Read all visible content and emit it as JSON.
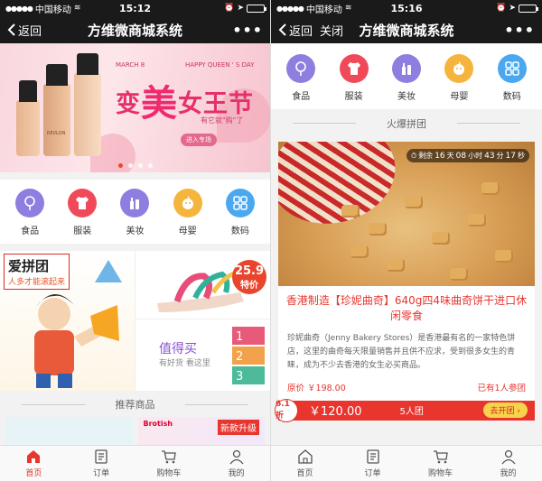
{
  "left": {
    "status": {
      "carrier": "中国移动",
      "time": "15:12"
    },
    "nav": {
      "back_label": "返回",
      "title": "方维微商城系统",
      "more": "•••"
    },
    "banner": {
      "march": "MARCH 8",
      "happy": "HAPPY QUEEN ' S DAY",
      "headline_pre": "变",
      "headline_mei": "美",
      "headline_post": "女王节",
      "sub": "有它就\"购\"了",
      "button": "进入专场",
      "brand": "REVLON"
    },
    "categories": [
      {
        "label": "食品",
        "icon": "lollipop-icon",
        "color": "#8e7ee0"
      },
      {
        "label": "服装",
        "icon": "shirt-icon",
        "color": "#f04a5a"
      },
      {
        "label": "美妆",
        "icon": "cosmetics-icon",
        "color": "#8e7ee0"
      },
      {
        "label": "母婴",
        "icon": "baby-icon",
        "color": "#f5b43c"
      },
      {
        "label": "数码",
        "icon": "grid-icon",
        "color": "#4aa8f0"
      }
    ],
    "promo": {
      "group_title": "爱拼团",
      "group_sub": "人多才能滚起来",
      "price_num": "25.9",
      "price_tag": "特价",
      "worth_title": "值得买",
      "worth_sub": "有好货 看这里"
    },
    "section_title": "推荐商品",
    "rec": {
      "tag": "新款升级",
      "brand": "Brotish"
    },
    "tabs": [
      "首页",
      "订单",
      "购物车",
      "我的"
    ]
  },
  "right": {
    "status": {
      "carrier": "中国移动",
      "time": "15:16"
    },
    "nav": {
      "back_label": "返回",
      "close_label": "关闭",
      "title": "方维微商城系统",
      "more": "•••"
    },
    "categories": [
      {
        "label": "食品",
        "icon": "lollipop-icon",
        "color": "#8e7ee0"
      },
      {
        "label": "服装",
        "icon": "shirt-icon",
        "color": "#f04a5a"
      },
      {
        "label": "美妆",
        "icon": "cosmetics-icon",
        "color": "#8e7ee0"
      },
      {
        "label": "母婴",
        "icon": "baby-icon",
        "color": "#f5b43c"
      },
      {
        "label": "数码",
        "icon": "grid-icon",
        "color": "#4aa8f0"
      }
    ],
    "section_title": "火爆拼团",
    "product": {
      "timer_prefix": "剩余",
      "timer_days": "16",
      "timer_days_unit": "天",
      "timer_hours": "08",
      "timer_hours_unit": "小时",
      "timer_mins": "43",
      "timer_mins_unit": "分",
      "timer_secs": "17",
      "timer_secs_unit": "秒",
      "title": "香港制造【珍妮曲奇】640g四4味曲奇饼干进口休闲零食",
      "desc": "珍妮曲奇（Jenny Bakery Stores）是香港最有名的一家特色饼店，这里的曲奇每天限量销售并且供不应求，受到很多女生的青睐，成为不少去香港的女生必买商品。",
      "orig_price": "原价 ￥198.00",
      "joined": "已有1人参团",
      "discount": "6.1折",
      "price": "￥120.00",
      "group_size": "5人团",
      "go_label": "去开团"
    },
    "tabs": [
      "首页",
      "订单",
      "购物车",
      "我的"
    ]
  },
  "colors": {
    "accent": "#e8352e",
    "navbar": "#1a1a1a",
    "purple": "#8a4fd1"
  }
}
